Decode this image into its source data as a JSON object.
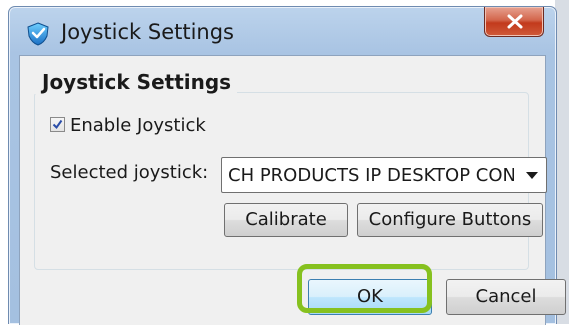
{
  "window": {
    "title": "Joystick Settings",
    "icon": "app-shield-icon",
    "close_icon": "close-x-icon"
  },
  "group": {
    "title": "Joystick Settings",
    "enable": {
      "label": "Enable Joystick",
      "checked": true
    },
    "selected_label": "Selected joystick:",
    "selected_value": "CH PRODUCTS IP DESKTOP CONTROLLER",
    "calibrate_label": "Calibrate",
    "configure_label": "Configure Buttons"
  },
  "footer": {
    "ok_label": "OK",
    "cancel_label": "Cancel"
  },
  "colors": {
    "highlight": "#86c11f",
    "titlebar": "#a9c4e3",
    "close": "#c23a1c"
  }
}
